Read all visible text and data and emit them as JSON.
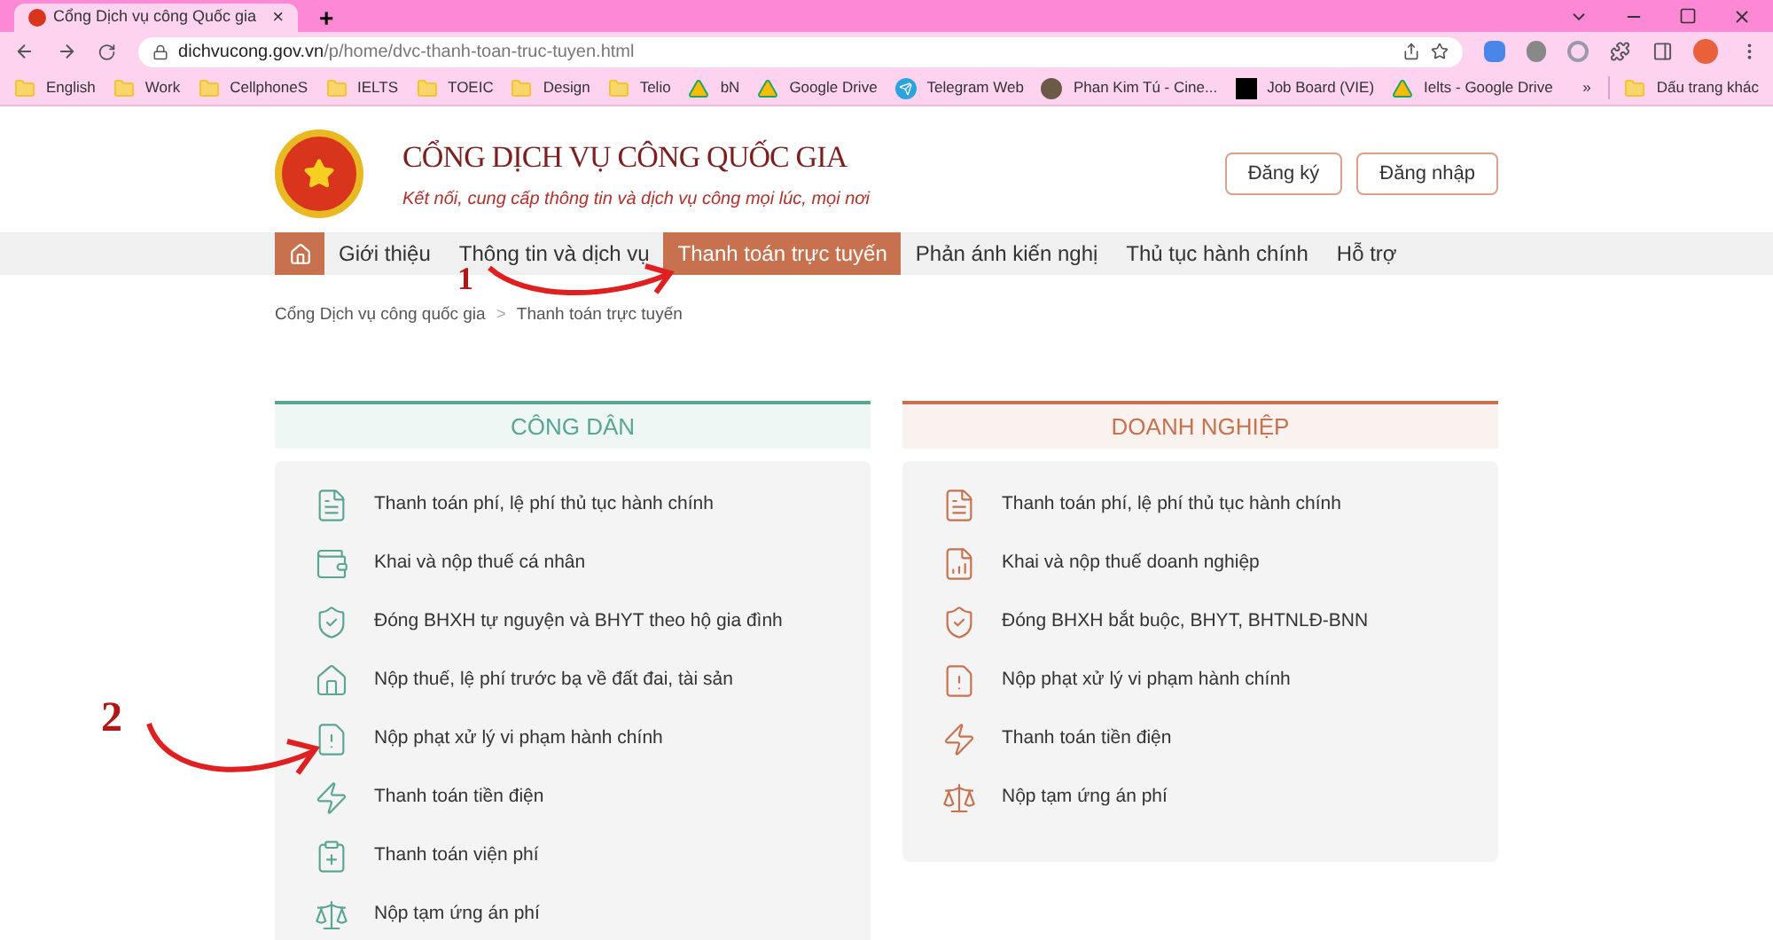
{
  "browser": {
    "tab": {
      "title": "Cổng Dịch vụ công Quốc gia",
      "close": "×"
    },
    "new_tab": "+",
    "address": {
      "domain": "dichvucong.gov.vn",
      "path": "/p/home/dvc-thanh-toan-truc-tuyen.html"
    },
    "bookmarks": [
      {
        "label": "English",
        "kind": "folder"
      },
      {
        "label": "Work",
        "kind": "folder"
      },
      {
        "label": "CellphoneS",
        "kind": "folder"
      },
      {
        "label": "IELTS",
        "kind": "folder"
      },
      {
        "label": "TOEIC",
        "kind": "folder"
      },
      {
        "label": "Design",
        "kind": "folder"
      },
      {
        "label": "Telio",
        "kind": "folder"
      },
      {
        "label": "bN",
        "kind": "drive"
      },
      {
        "label": "Google Drive",
        "kind": "drive"
      },
      {
        "label": "Telegram Web",
        "kind": "telegram"
      },
      {
        "label": "Phan Kim Tú - Cine...",
        "kind": "avatar"
      },
      {
        "label": "Job Board (VIE)",
        "kind": "board"
      },
      {
        "label": "Ielts - Google Drive",
        "kind": "drive"
      }
    ],
    "more": "»",
    "other_bookmarks": "Dấu trang khác"
  },
  "site": {
    "title": "CỔNG DỊCH VỤ CÔNG QUỐC GIA",
    "tagline": "Kết nối, cung cấp thông tin và dịch vụ công mọi lúc, mọi nơi",
    "buttons": [
      "Đăng ký",
      "Đăng nhập"
    ],
    "nav": [
      {
        "label": "Giới thiệu",
        "selected": false
      },
      {
        "label": "Thông tin và dịch vụ",
        "selected": false
      },
      {
        "label": "Thanh toán trực tuyến",
        "selected": true
      },
      {
        "label": "Phản ánh kiến nghị",
        "selected": false
      },
      {
        "label": "Thủ tục hành chính",
        "selected": false
      },
      {
        "label": "Hỗ trợ",
        "selected": false
      }
    ],
    "breadcrumb": [
      "Cổng Dịch vụ công quốc gia",
      "Thanh toán trực tuyến"
    ],
    "breadcrumb_separator": ">",
    "sections": [
      {
        "title": "CÔNG DÂN",
        "color": "#5aa594",
        "items": [
          {
            "label": "Thanh toán phí, lệ phí thủ tục hành chính",
            "kind": "document"
          },
          {
            "label": "Khai và nộp thuế cá nhân",
            "kind": "moneybag"
          },
          {
            "label": "Đóng BHXH tự nguyện và BHYT theo hộ gia đình",
            "kind": "shield"
          },
          {
            "label": "Nộp thuế, lệ phí trước bạ về đất đai, tài sản",
            "kind": "house"
          },
          {
            "label": "Nộp phạt xử lý vi phạm hành chính",
            "kind": "warning"
          },
          {
            "label": "Thanh toán tiền điện",
            "kind": "tower"
          },
          {
            "label": "Thanh toán viện phí",
            "kind": "clipboard"
          },
          {
            "label": "Nộp tạm ứng án phí",
            "kind": "scales"
          }
        ]
      },
      {
        "title": "DOANH NGHIỆP",
        "color": "#c8714f",
        "items": [
          {
            "label": "Thanh toán phí, lệ phí thủ tục hành chính",
            "kind": "document"
          },
          {
            "label": "Khai và nộp thuế doanh nghiệp",
            "kind": "chart"
          },
          {
            "label": "Đóng BHXH bắt buộc, BHYT, BHTNLĐ-BNN",
            "kind": "shield"
          },
          {
            "label": "Nộp phạt xử lý vi phạm hành chính",
            "kind": "warning"
          },
          {
            "label": "Thanh toán tiền điện",
            "kind": "tower"
          },
          {
            "label": "Nộp tạm ứng án phí",
            "kind": "scales"
          }
        ]
      }
    ]
  },
  "annotations": [
    "1",
    "2"
  ]
}
